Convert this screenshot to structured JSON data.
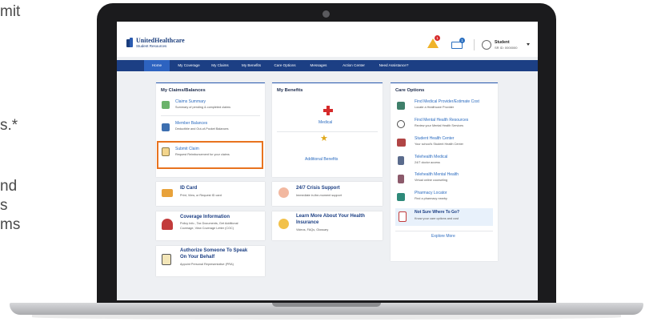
{
  "side_text": {
    "line1": "mit",
    "line2": "s.*",
    "line3": "nd",
    "line4": "s",
    "line5": "ms"
  },
  "header": {
    "brand": "UnitedHealthcare",
    "brand_sub": "Student Resources",
    "alert_count": "1",
    "mail_count": "1",
    "user_name": "Student",
    "user_id": "SR ID: 0000000"
  },
  "nav": {
    "items": [
      "Home",
      "My Coverage",
      "My Claims",
      "My Benefits",
      "Care Options",
      "Messages",
      "Action Center",
      "Need Assistance?"
    ],
    "active": "Home"
  },
  "claims": {
    "title": "My Claims/Balances",
    "rows": [
      {
        "title": "Claims Summary",
        "sub": "Summary of pending & completed claims"
      },
      {
        "title": "Member Balances",
        "sub": "Deductible and Out-of-Pocket Balances"
      },
      {
        "title": "Submit Claim",
        "sub": "Request Reimbursement for your claims"
      }
    ]
  },
  "benefits": {
    "title": "My Benefits",
    "medical": "Medical",
    "additional": "Additional Benefits"
  },
  "care": {
    "title": "Care Options",
    "rows": [
      {
        "title": "Find Medical Provider/Estimate Cost",
        "sub": "Locate a Healthcare Provider"
      },
      {
        "title": "Find Mental Health Resources",
        "sub": "Review your Mental Health Services"
      },
      {
        "title": "Student Health Center",
        "sub": "Your school's Student Health Center"
      },
      {
        "title": "Telehealth Medical",
        "sub": "24/7 doctor access"
      },
      {
        "title": "Telehealth Mental Health",
        "sub": "Virtual online counseling"
      },
      {
        "title": "Pharmacy Locator",
        "sub": "Find a pharmacy nearby"
      }
    ],
    "not_sure_title": "Not Sure Where To Go?",
    "not_sure_sub": "Know your care options and cost",
    "explore": "Explore More"
  },
  "tiles": {
    "id_card": {
      "title": "ID Card",
      "sub": "Print, View, or Request ID card"
    },
    "crisis": {
      "title": "24/7 Crisis Support",
      "sub": "Immediate in-the-moment support"
    },
    "coverage": {
      "title": "Coverage Information",
      "sub1": "Policy Info., Tax Documents, Get Additional",
      "sub2": "Coverage, View Coverage Letter (COC)"
    },
    "learn": {
      "title1": "Learn More About Your Health",
      "title2": "Insurance",
      "sub": "Videos, FAQs, Glossary"
    },
    "authorize": {
      "title1": "Authorize Someone To Speak",
      "title2": "On Your Behalf",
      "sub": "Appoint Personal Representative (PRA)"
    }
  },
  "colors": {
    "nav_bg": "#1c3f84",
    "nav_active": "#2d63c0",
    "link": "#2c6cc0",
    "highlight": "#e8731f",
    "alert": "#f0b32a"
  }
}
